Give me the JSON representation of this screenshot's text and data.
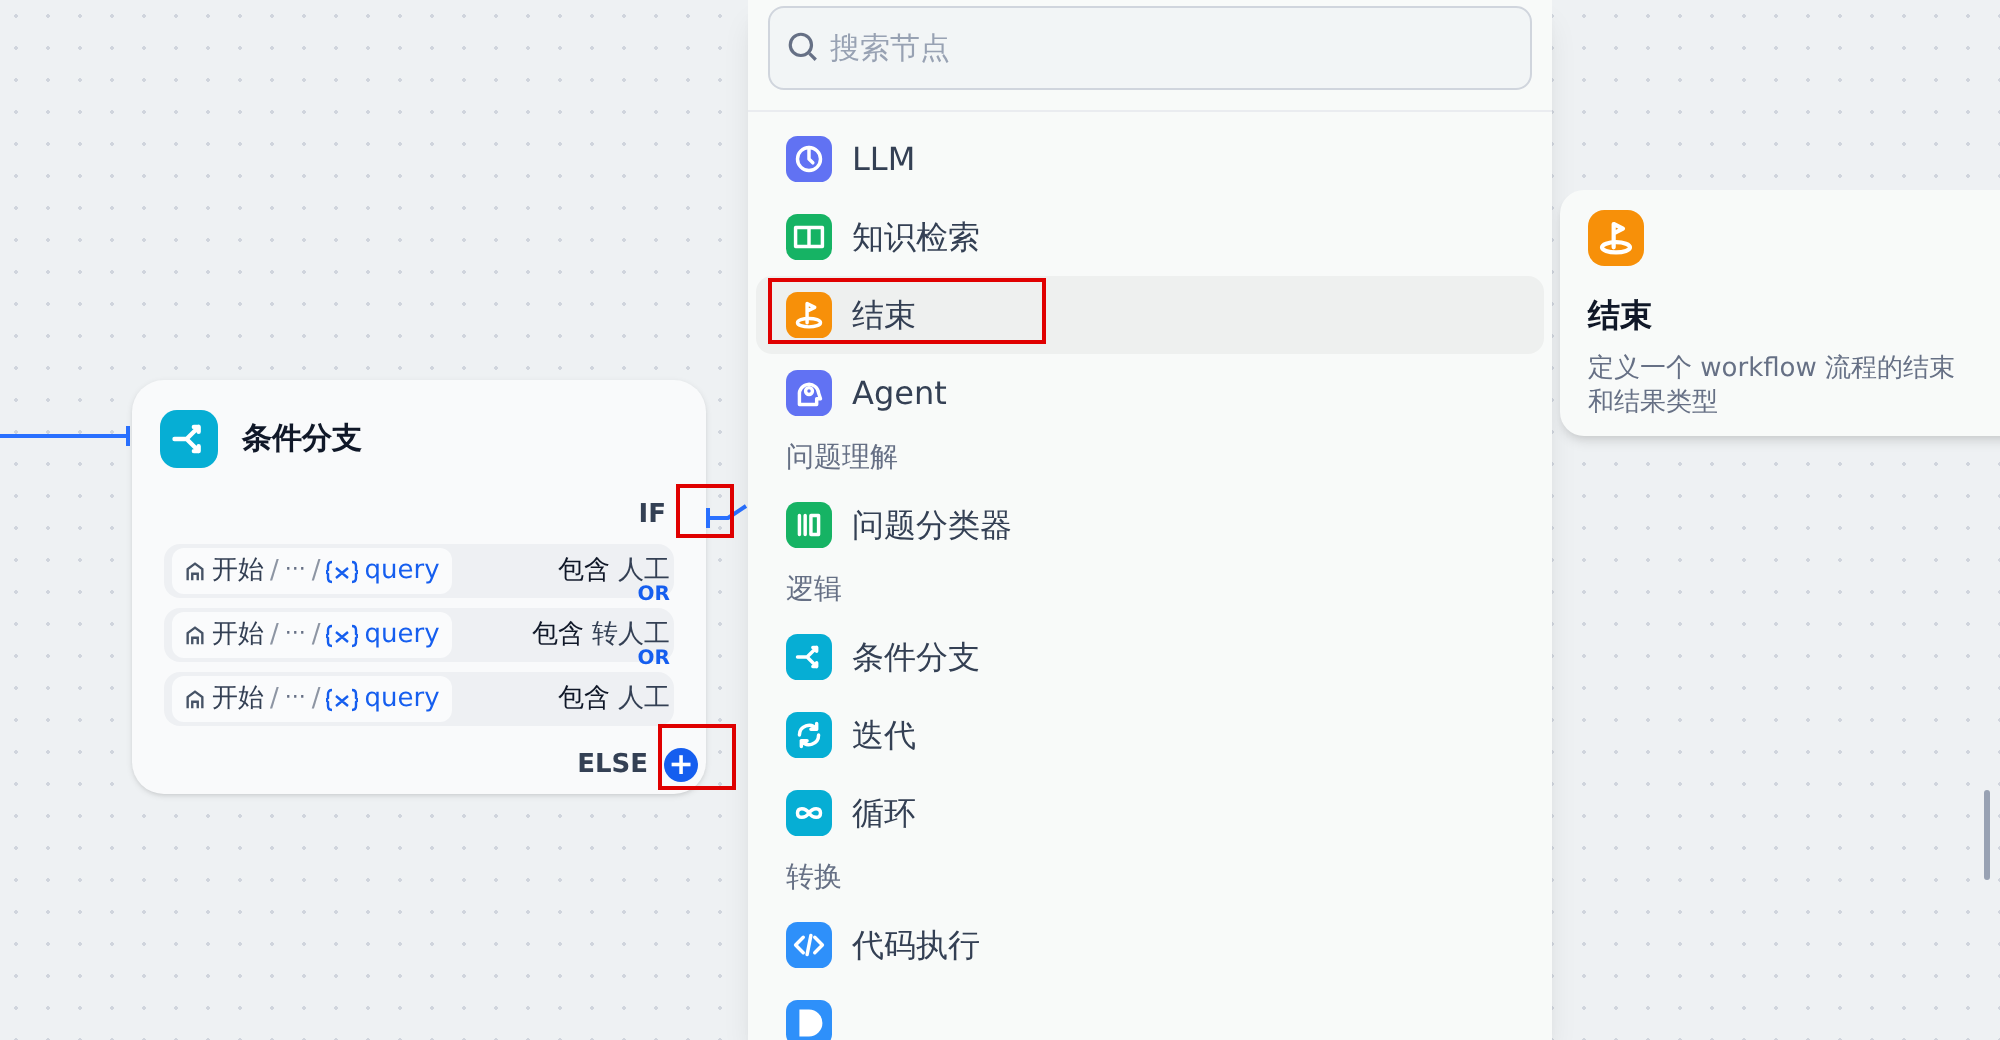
{
  "node": {
    "title": "条件分支",
    "if_label": "IF",
    "else_label": "ELSE",
    "conditions": [
      {
        "source": "开始",
        "separator_1": "/",
        "ellipsis": "···",
        "separator_2": "/",
        "variable": "query",
        "operator": "包含",
        "value": "人工"
      },
      {
        "source": "开始",
        "separator_1": "/",
        "ellipsis": "···",
        "separator_2": "/",
        "variable": "query",
        "operator": "包含",
        "value": "转人工"
      },
      {
        "source": "开始",
        "separator_1": "/",
        "ellipsis": "···",
        "separator_2": "/",
        "variable": "query",
        "operator": "包含",
        "value": "人工"
      }
    ],
    "logic": [
      "OR",
      "OR"
    ],
    "add_button": "+"
  },
  "menu": {
    "search": {
      "placeholder": "搜索节点"
    },
    "entries": [
      {
        "kind": "item",
        "label": "LLM",
        "color": "#6172f3",
        "selected": false
      },
      {
        "kind": "item",
        "label": "知识检索",
        "color": "#16b364",
        "selected": false
      },
      {
        "kind": "item",
        "label": "结束",
        "color": "#f79009",
        "selected": true
      },
      {
        "kind": "item",
        "label": "Agent",
        "color": "#6172f3",
        "selected": false
      },
      {
        "kind": "group",
        "label": "问题理解"
      },
      {
        "kind": "item",
        "label": "问题分类器",
        "color": "#16b364",
        "selected": false
      },
      {
        "kind": "group",
        "label": "逻辑"
      },
      {
        "kind": "item",
        "label": "条件分支",
        "color": "#06aed4",
        "selected": false
      },
      {
        "kind": "item",
        "label": "迭代",
        "color": "#06aed4",
        "selected": false
      },
      {
        "kind": "item",
        "label": "循环",
        "color": "#06aed4",
        "selected": false
      },
      {
        "kind": "group",
        "label": "转换"
      },
      {
        "kind": "item",
        "label": "代码执行",
        "color": "#2e90fa",
        "selected": false
      },
      {
        "kind": "item",
        "color": "#2e90fa",
        "selected": false
      }
    ]
  },
  "tooltip": {
    "title": "结束",
    "description_lines": [
      "定义一个 workflow 流程的结束",
      "和结果类型"
    ],
    "color": "#f79009"
  }
}
